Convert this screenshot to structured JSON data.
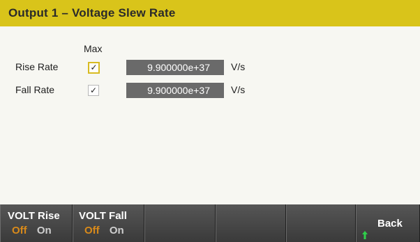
{
  "header": {
    "title": "Output 1 – Voltage Slew Rate"
  },
  "form": {
    "max_label": "Max",
    "rise": {
      "label": "Rise Rate",
      "checked": "✓",
      "value": "9.900000e+37",
      "unit": "V/s"
    },
    "fall": {
      "label": "Fall Rate",
      "checked": "✓",
      "value": "9.900000e+37",
      "unit": "V/s"
    }
  },
  "softkeys": [
    {
      "name": "VOLT Rise",
      "off": "Off",
      "on": "On"
    },
    {
      "name": "VOLT Fall",
      "off": "Off",
      "on": "On"
    },
    {
      "name": ""
    },
    {
      "name": ""
    },
    {
      "name": ""
    },
    {
      "name": "Back",
      "icon": "up-arrow-icon"
    }
  ],
  "colors": {
    "header": "#d9c41a",
    "field": "#6a6a6a",
    "softkey_bar": "#4a4a4a",
    "off_accent": "#d98a1a"
  }
}
